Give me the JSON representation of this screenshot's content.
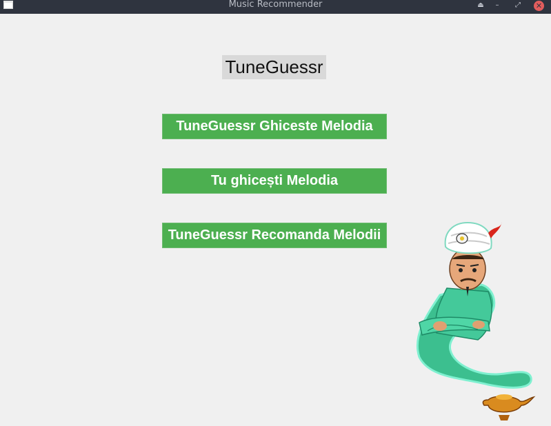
{
  "window": {
    "title": "Music Recommender",
    "controls": [
      "eject",
      "minimize",
      "restore",
      "close"
    ]
  },
  "main": {
    "heading": "TuneGuessr",
    "buttons": [
      {
        "label": "TuneGuessr Ghiceste Melodia"
      },
      {
        "label": "Tu ghicești Melodia"
      },
      {
        "label": "TuneGuessr Recomanda Melodii"
      }
    ]
  },
  "colors": {
    "titlebar": "#2f343f",
    "background": "#f0f0f0",
    "button": "#4caf50",
    "button_text": "#ffffff",
    "heading_bg": "#d9d9d9"
  },
  "icons": {
    "mascot": "genie-mascot-icon"
  }
}
